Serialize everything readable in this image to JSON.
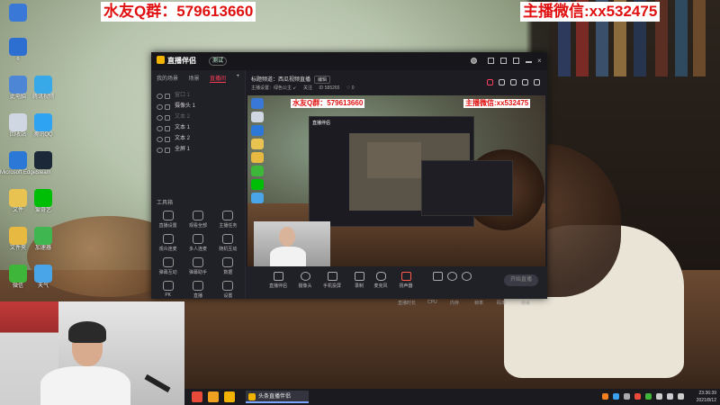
{
  "overlay": {
    "qq_group": "水友Q群：579613660",
    "wechat": "主播微信:xx532475"
  },
  "desktop_icons": [
    {
      "name": "icon-1",
      "label": "",
      "color": "#3a78d8"
    },
    {
      "name": "icon-2",
      "label": "6",
      "color": "#2d6fd1"
    },
    {
      "name": "icon-3",
      "label": "此电脑",
      "color": "#4c86d4"
    },
    {
      "name": "icon-4",
      "label": "腾讯视频",
      "color": "#37a8e8"
    },
    {
      "name": "icon-5",
      "label": "回收站",
      "color": "#cfd7e3"
    },
    {
      "name": "icon-6",
      "label": "腾讯QQ",
      "color": "#2ea3f2"
    },
    {
      "name": "icon-7",
      "label": "Microsoft Edge",
      "color": "#2b78d6"
    },
    {
      "name": "icon-8",
      "label": "Steam",
      "color": "#1b2838"
    },
    {
      "name": "icon-9",
      "label": "文件",
      "color": "#e8c352"
    },
    {
      "name": "icon-10",
      "label": "爱奇艺",
      "color": "#00be06"
    },
    {
      "name": "icon-11",
      "label": "文件夹",
      "color": "#e7b940"
    },
    {
      "name": "icon-12",
      "label": "加速器",
      "color": "#3fb64f"
    },
    {
      "name": "icon-13",
      "label": "微信",
      "color": "#3eb63a"
    },
    {
      "name": "icon-14",
      "label": "天气",
      "color": "#4aa5e8"
    }
  ],
  "app": {
    "name": "直播伴侣",
    "badge": "测试",
    "tabs": [
      "我的场景",
      "场景",
      "直播间"
    ],
    "sources": [
      {
        "label": "窗口 1",
        "dim": true
      },
      {
        "label": "摄像头 1",
        "dim": false
      },
      {
        "label": "文本 2",
        "dim": true
      },
      {
        "label": "文本 1",
        "dim": false
      },
      {
        "label": "文本 2",
        "dim": false
      },
      {
        "label": "全屏 1",
        "dim": false
      }
    ],
    "tools_title": "工具箱",
    "tools": [
      "直播设置",
      "观看全部",
      "主播任务",
      "观众连麦",
      "多人连麦",
      "随机互动",
      "弹幕互动",
      "弹幕助手",
      "数据",
      "PK",
      "直播",
      "设置"
    ],
    "top_line1": "标题频道：西瓜视频直播",
    "top_tag": "编辑",
    "top_line2": [
      "主播设置：绿色公主 ↙",
      "关注",
      "ID 585265",
      "♡ 0"
    ],
    "bottom_buttons": [
      "直播伴侣",
      "摄像头",
      "手机投屏",
      "录制",
      "麦克风",
      "扬声器"
    ],
    "live_button": "开始直播",
    "status": [
      "直播时长",
      "CPU",
      "内存",
      "帧率",
      "码率",
      "帧丢"
    ]
  },
  "preview": {
    "qq": "水友Q群：579613660",
    "wx": "主播微信:xx532475",
    "inner_title": "直播伴侣"
  },
  "taskbar": {
    "task_label": "头条直播伴侣",
    "time": "23:36:39",
    "date": "2021/8/12"
  }
}
